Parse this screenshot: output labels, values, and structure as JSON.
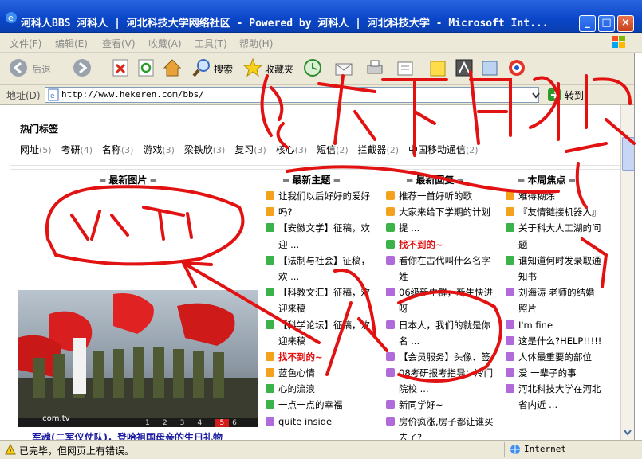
{
  "window": {
    "title": "河科人BBS 河科人 | 河北科技大学网络社区 - Powered by 河科人 | 河北科技大学 - Microsoft Int..."
  },
  "menu": [
    "文件(F)",
    "编辑(E)",
    "查看(V)",
    "收藏(A)",
    "工具(T)",
    "帮助(H)"
  ],
  "toolbar": {
    "back_label": "后退",
    "search_label": "搜索",
    "favorites_label": "收藏夹"
  },
  "address": {
    "label": "地址(D)",
    "url": "http://www.hekeren.com/bbs/",
    "go_label": "转到"
  },
  "hot_tags": {
    "heading": "热门标签",
    "tags": [
      {
        "name": "网址",
        "count": "(5)"
      },
      {
        "name": "考研",
        "count": "(4)"
      },
      {
        "name": "名称",
        "count": "(3)"
      },
      {
        "name": "游戏",
        "count": "(3)"
      },
      {
        "name": "梁铁欣",
        "count": "(3)"
      },
      {
        "name": "复习",
        "count": "(3)"
      },
      {
        "name": "核心",
        "count": "(3)"
      },
      {
        "name": "短信",
        "count": "(2)"
      },
      {
        "name": "拦截器",
        "count": "(2)"
      },
      {
        "name": "中国移动通信",
        "count": "(2)"
      }
    ]
  },
  "sections": {
    "images": "最新图片",
    "topics": "最新主题",
    "replies": "最新回复",
    "weekly": "本周焦点"
  },
  "topics": [
    "让我们以后好好的爱好",
    "吗?",
    "【安徽文学】征稿，欢",
    "迎 ...",
    "【法制与社会】征稿，",
    "欢 ...",
    "【科教文汇】征稿，欢",
    "迎来稿",
    "【科学论坛】征稿，欢",
    "迎来稿",
    "找不到的~",
    "蓝色心情",
    "心的流浪",
    "一点一点的幸福",
    "quite inside"
  ],
  "replies": [
    "推荐一首好听的歌",
    "大家来给下学期的计划",
    "提 ...",
    "找不到的~",
    "看你在古代叫什么名字",
    "姓",
    "06级新生群，新生快进",
    "呀",
    "日本人，我们的就是你",
    "名 ...",
    "【会员服务】头像、签",
    "08考研报考指导：冷门",
    "院校 ...",
    "新同学好~",
    "房价疯涨,房子都让谁买",
    "去了?"
  ],
  "weekly": [
    "难得糊涂",
    "『友情链接机器人』",
    "关于科大人工湖的问",
    "题",
    "谁知道何时发录取通",
    "知书",
    "刘海涛 老师的结婚",
    "照片",
    "I'm fine",
    "这是什么?HELP!!!!!",
    "人体最重要的部位",
    "爱 一辈子的事",
    "河北科技大学在河北",
    "省内近 ..."
  ],
  "photo": {
    "watermark": ".com.tv",
    "pages": [
      "1",
      "2",
      "3",
      "4",
      "5",
      "6"
    ],
    "caption": "军魂(二军仪仗队)，登哈祖国母亲的生日礼物"
  },
  "status": {
    "text": "已完毕，但网页上有错误。",
    "zone": "Internet"
  },
  "annotations": {
    "top": "能否下自动换行",
    "left": "空白",
    "middle": "太宽"
  },
  "colors": {
    "title_bar": "#0a46c8",
    "ink": "#e21212",
    "link_red": "#e21212"
  }
}
